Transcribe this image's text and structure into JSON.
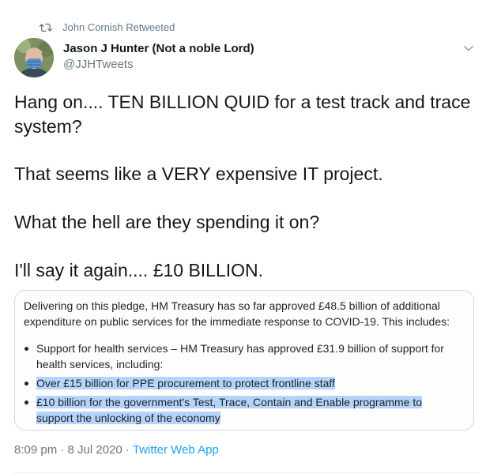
{
  "retweet": {
    "icon": "retweet-icon",
    "text": "John Cornish Retweeted"
  },
  "author": {
    "name": "Jason J Hunter (Not a noble Lord)",
    "handle": "@JJHTweets"
  },
  "tweet": {
    "line1": "Hang on....  TEN BILLION QUID for a test track and trace",
    "line2": "system?",
    "line3": "That seems like a VERY expensive IT project.",
    "line4": "What the hell are they spending it on?",
    "line5": "I'll say it again.... £10 BILLION."
  },
  "card": {
    "intro_line1": "Delivering on this pledge, HM Treasury has so far approved £48.5 billion of additional",
    "intro_line2": "expenditure on public services for the immediate response to COVID-19. This includes:",
    "bullet1_line1": "Support for health services – HM Treasury has approved £31.9 billion of support for",
    "bullet1_line2": "health services, including:",
    "bullet2": "Over £15 billion for PPE procurement to protect frontline staff",
    "bullet3_line1": "£10 billion for the government's Test, Trace, Contain and Enable programme to",
    "bullet3_line2": "support the unlocking of the economy",
    "highlight_color": "#b4d4fb"
  },
  "meta": {
    "time": "8:09 pm · 8 Jul 2020 · ",
    "app": "Twitter Web App"
  },
  "colors": {
    "accent": "#1da1f2",
    "secondary_text": "#657786",
    "text": "#14171a"
  }
}
